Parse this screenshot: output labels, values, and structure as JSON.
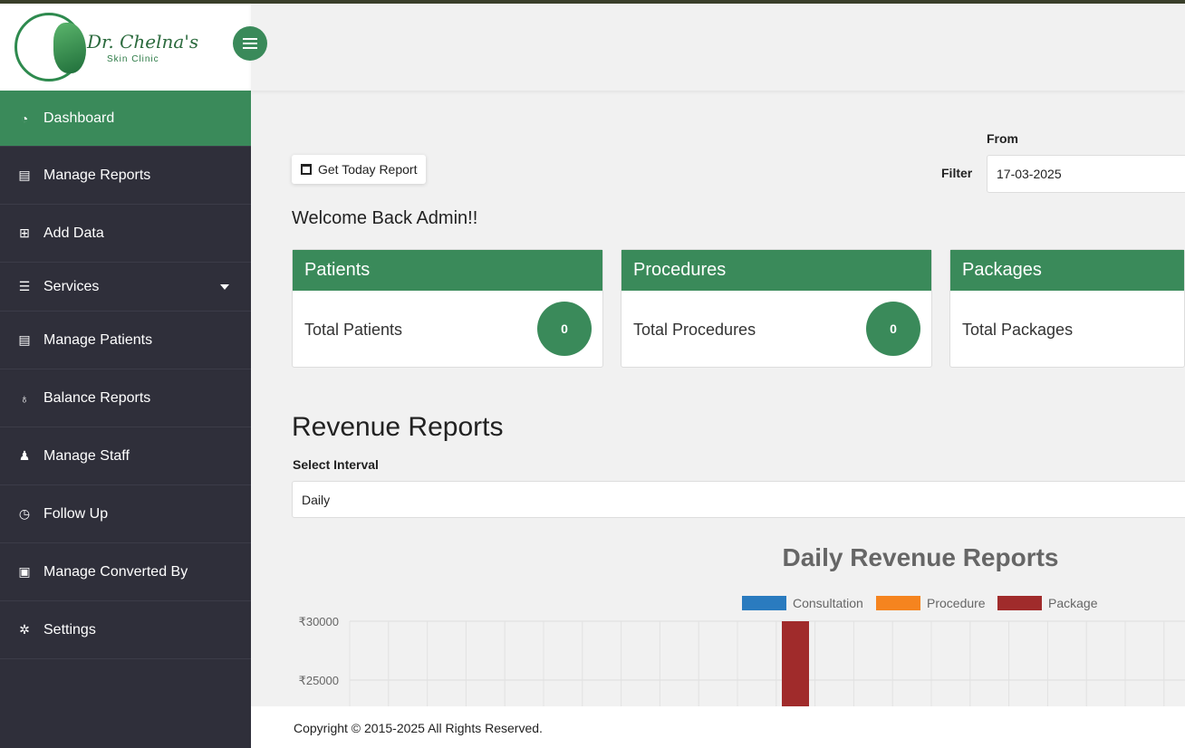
{
  "brand": {
    "name": "Dr. Chelna's",
    "subtitle": "Skin Clinic"
  },
  "sidebar": {
    "items": [
      {
        "label": "Dashboard",
        "icon": "dashboard-icon"
      },
      {
        "label": "Manage Reports",
        "icon": "report-icon"
      },
      {
        "label": "Add Data",
        "icon": "plus-square-icon"
      },
      {
        "label": "Services",
        "icon": "list-icon"
      },
      {
        "label": "Manage Patients",
        "icon": "document-icon"
      },
      {
        "label": "Balance Reports",
        "icon": "money-bag-icon"
      },
      {
        "label": "Manage Staff",
        "icon": "user-icon"
      },
      {
        "label": "Follow Up",
        "icon": "clock-icon"
      },
      {
        "label": "Manage Converted By",
        "icon": "id-card-icon"
      },
      {
        "label": "Settings",
        "icon": "gear-icon"
      }
    ]
  },
  "toolbar": {
    "today_report_label": "Get Today Report"
  },
  "filter": {
    "label": "Filter",
    "from_label": "From",
    "from_value": "17-03-2025"
  },
  "welcome": "Welcome Back Admin!!",
  "cards": [
    {
      "title": "Patients",
      "label": "Total Patients",
      "count": "0"
    },
    {
      "title": "Procedures",
      "label": "Total Procedures",
      "count": "0"
    },
    {
      "title": "Packages",
      "label": "Total Packages",
      "count": ""
    }
  ],
  "revenue": {
    "title": "Revenue Reports",
    "interval_label": "Select Interval",
    "interval_value": "Daily"
  },
  "colors": {
    "accent": "#3a8a5a",
    "sidebar": "#2f2f3a"
  },
  "chart_data": {
    "type": "bar",
    "title": "Daily Revenue Reports",
    "series": [
      {
        "name": "Consultation",
        "color": "#2a7bbf"
      },
      {
        "name": "Procedure",
        "color": "#f5841f"
      },
      {
        "name": "Package",
        "color": "#a02b2b"
      }
    ],
    "ytick_labels": [
      "₹30000",
      "₹25000"
    ],
    "grid": true,
    "legend_placement": "top"
  },
  "footer": {
    "text": "Copyright © 2015-2025 All Rights Reserved."
  }
}
